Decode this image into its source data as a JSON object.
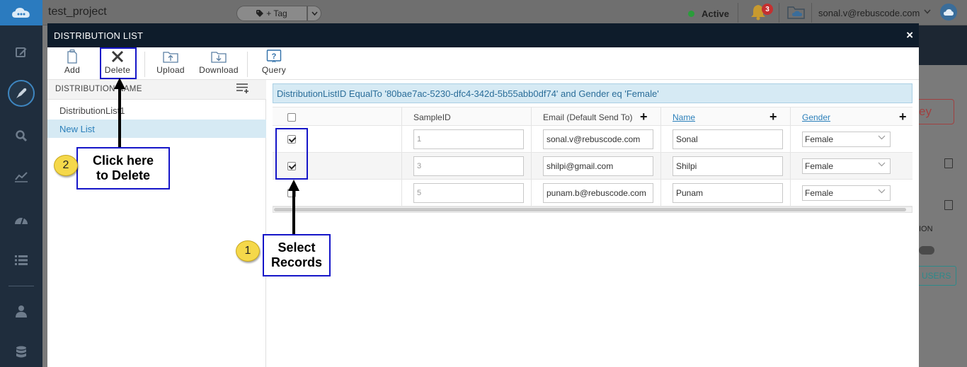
{
  "header": {
    "project": "test_project",
    "tag_label": "+ Tag",
    "status": "Active",
    "notification_count": "3",
    "user_email": "sonal.v@rebuscode.com"
  },
  "background": {
    "key_fragment": "ey",
    "ion_fragment": "ION",
    "users_fragment": "USERS"
  },
  "modal": {
    "title": "DISTRIBUTION LIST",
    "toolbar": {
      "add": "Add",
      "delete": "Delete",
      "upload": "Upload",
      "download": "Download",
      "query": "Query"
    },
    "left_panel": {
      "header": "DISTRIBUTION NAME",
      "items": [
        "DistributionList1",
        "New List"
      ]
    },
    "filter": "DistributionListID EqualTo '80bae7ac-5230-dfc4-342d-5b55abb0df74' and Gender eq 'Female'",
    "grid": {
      "columns": {
        "sample_id": "SampleID",
        "email": "Email (Default Send To)",
        "name": "Name",
        "gender": "Gender"
      },
      "rows": [
        {
          "checked": true,
          "sample_id": "1",
          "email": "sonal.v@rebuscode.com",
          "name": "Sonal",
          "gender": "Female"
        },
        {
          "checked": true,
          "sample_id": "3",
          "email": "shilpi@gmail.com",
          "name": "Shilpi",
          "gender": "Female"
        },
        {
          "checked": false,
          "sample_id": "5",
          "email": "punam.b@rebuscode.com",
          "name": "Punam",
          "gender": "Female"
        }
      ]
    }
  },
  "annotations": {
    "step1": {
      "number": "1",
      "line1": "Select",
      "line2": "Records"
    },
    "step2": {
      "number": "2",
      "line1": "Click here",
      "line2": "to Delete"
    }
  },
  "colors": {
    "accent": "#2a7fba",
    "modal_header": "#0e1c2b",
    "annotation_border": "#1515c8",
    "annotation_badge": "#f5d84a",
    "selected_row": "#d6eaf4"
  }
}
